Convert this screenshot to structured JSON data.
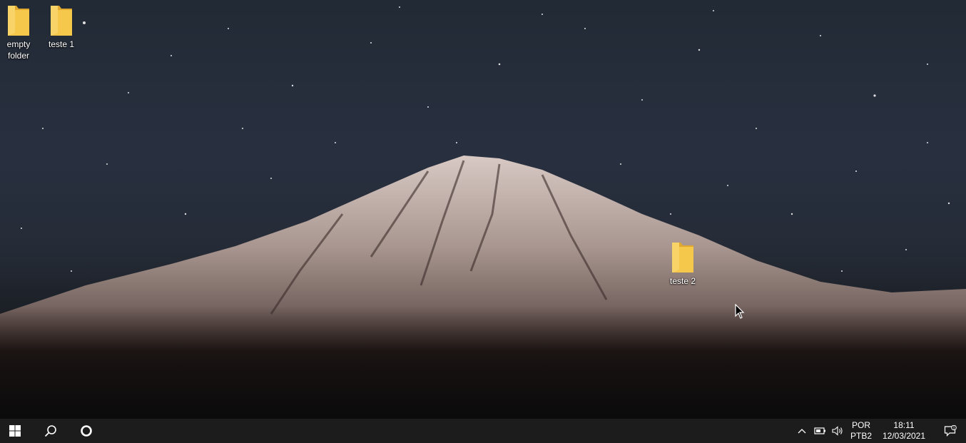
{
  "desktop": {
    "icons": [
      {
        "label": "empty folder"
      },
      {
        "label": "teste 1"
      },
      {
        "label": "teste 2"
      }
    ]
  },
  "taskbar": {
    "start": {
      "icon": "windows-logo-icon"
    },
    "search": {
      "icon": "search-icon"
    },
    "cortana": {
      "icon": "cortana-circle-icon"
    },
    "tray": {
      "chevron": {
        "icon": "chevron-up-icon"
      },
      "battery": {
        "icon": "battery-icon"
      },
      "volume": {
        "icon": "volume-icon"
      },
      "language": {
        "line1": "POR",
        "line2": "PTB2"
      },
      "clock": {
        "time": "18:11",
        "date": "12/03/2021"
      },
      "notifications": {
        "icon": "notification-icon"
      }
    }
  },
  "colors": {
    "taskbar_bg": "#1c1c1c",
    "folder_yellow": "#f5c84c",
    "folder_shadow": "#e0a82e"
  }
}
